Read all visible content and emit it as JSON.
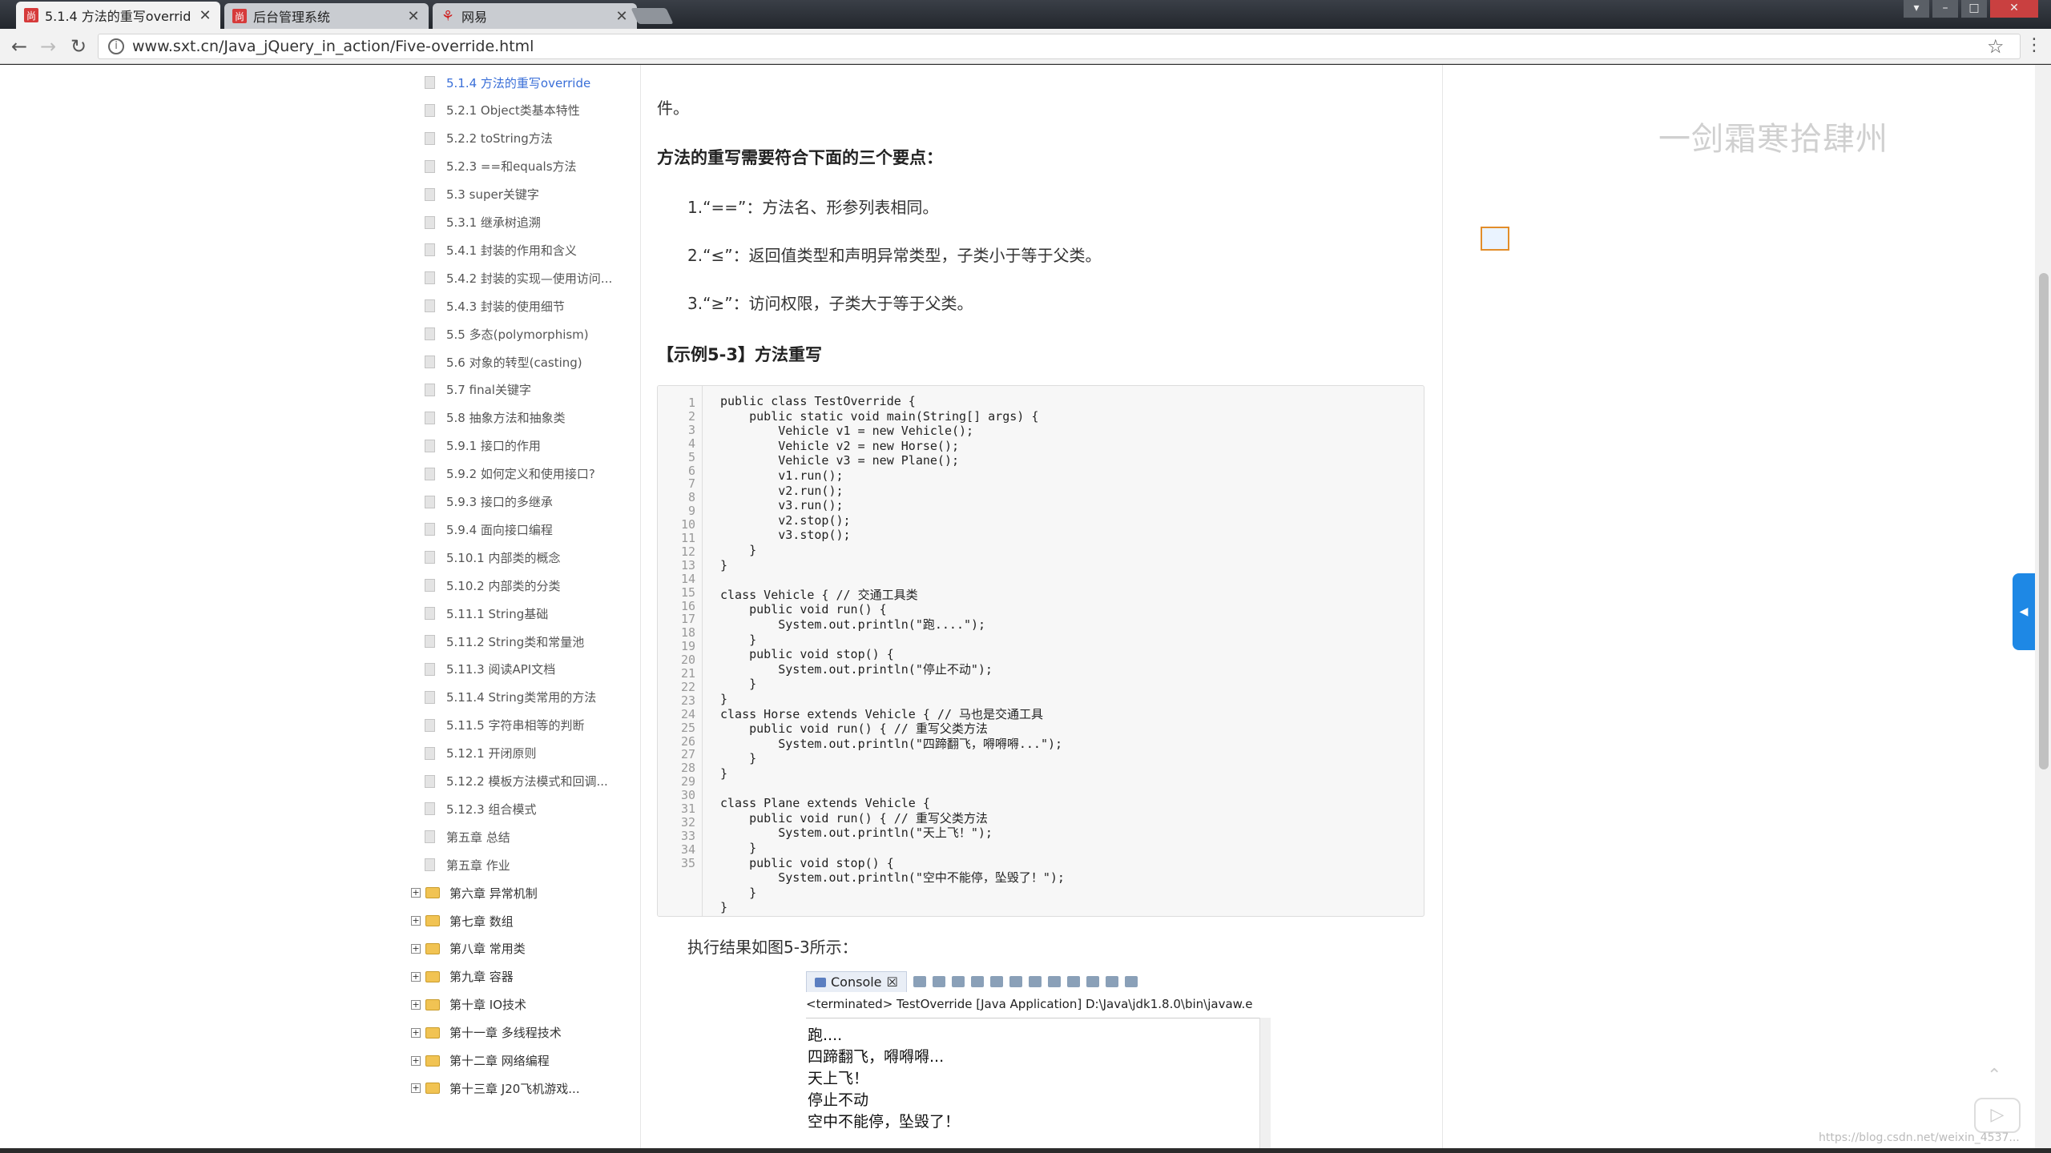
{
  "browser": {
    "tabs": [
      {
        "label": "5.1.4 方法的重写overrid",
        "favicon": "尚"
      },
      {
        "label": "后台管理系统",
        "favicon": "尚"
      },
      {
        "label": "网易",
        "favicon": "网"
      }
    ],
    "url": "www.sxt.cn/Java_jQuery_in_action/Five-override.html"
  },
  "toc": {
    "items": [
      {
        "label": "5.1.4 方法的重写override",
        "active": true
      },
      {
        "label": "5.2.1 Object类基本特性"
      },
      {
        "label": "5.2.2 toString方法"
      },
      {
        "label": "5.2.3 ==和equals方法"
      },
      {
        "label": "5.3 super关键字"
      },
      {
        "label": "5.3.1 继承树追溯"
      },
      {
        "label": "5.4.1 封装的作用和含义"
      },
      {
        "label": "5.4.2 封装的实现—使用访问..."
      },
      {
        "label": "5.4.3 封装的使用细节"
      },
      {
        "label": "5.5 多态(polymorphism)"
      },
      {
        "label": "5.6 对象的转型(casting)"
      },
      {
        "label": "5.7 final关键字"
      },
      {
        "label": "5.8 抽象方法和抽象类"
      },
      {
        "label": "5.9.1 接口的作用"
      },
      {
        "label": "5.9.2 如何定义和使用接口?"
      },
      {
        "label": "5.9.3 接口的多继承"
      },
      {
        "label": "5.9.4 面向接口编程"
      },
      {
        "label": "5.10.1 内部类的概念"
      },
      {
        "label": "5.10.2 内部类的分类"
      },
      {
        "label": "5.11.1 String基础"
      },
      {
        "label": "5.11.2 String类和常量池"
      },
      {
        "label": "5.11.3 阅读API文档"
      },
      {
        "label": "5.11.4 String类常用的方法"
      },
      {
        "label": "5.11.5 字符串相等的判断"
      },
      {
        "label": "5.12.1 开闭原则"
      },
      {
        "label": "5.12.2 模板方法模式和回调..."
      },
      {
        "label": "5.12.3 组合模式"
      },
      {
        "label": "第五章 总结"
      },
      {
        "label": "第五章 作业"
      }
    ],
    "chapters": [
      "第六章 异常机制",
      "第七章 数组",
      "第八章 常用类",
      "第九章 容器",
      "第十章 IO技术",
      "第十一章 多线程技术",
      "第十二章 网络编程",
      "第十三章 J20飞机游戏..."
    ]
  },
  "content": {
    "fragment": "件。",
    "heading": "方法的重写需要符合下面的三个要点：",
    "points": [
      "1.“==”：方法名、形参列表相同。",
      "2.“≤”：返回值类型和声明异常类型，子类小于等于父类。",
      "3.“≥”：访问权限，子类大于等于父类。"
    ],
    "example_title": "【示例5-3】方法重写",
    "code_lines": [
      "public class TestOverride {",
      "    public static void main(String[] args) {",
      "        Vehicle v1 = new Vehicle();",
      "        Vehicle v2 = new Horse();",
      "        Vehicle v3 = new Plane();",
      "        v1.run();",
      "        v2.run();",
      "        v3.run();",
      "        v2.stop();",
      "        v3.stop();",
      "    }",
      "}",
      "",
      "class Vehicle { // 交通工具类",
      "    public void run() {",
      "        System.out.println(\"跑....\");",
      "    }",
      "    public void stop() {",
      "        System.out.println(\"停止不动\");",
      "    }",
      "}",
      "class Horse extends Vehicle { // 马也是交通工具",
      "    public void run() { // 重写父类方法",
      "        System.out.println(\"四蹄翻飞，嘚嘚嘚...\");",
      "    }",
      "}",
      "",
      "class Plane extends Vehicle {",
      "    public void run() { // 重写父类方法",
      "        System.out.println(\"天上飞！\");",
      "    }",
      "    public void stop() {",
      "        System.out.println(\"空中不能停，坠毁了！\");",
      "    }",
      "}"
    ],
    "line_numbers": [
      "1",
      "2",
      "3",
      "4",
      "5",
      "6",
      "7",
      "8",
      "9",
      "10",
      "11",
      "12",
      "13",
      "14",
      "15",
      "16",
      "17",
      "18",
      "19",
      "20",
      "21",
      "22",
      "23",
      "24",
      "25",
      "26",
      "27",
      "28",
      "29",
      "30",
      "31",
      "32",
      "33",
      "34",
      "35"
    ],
    "result_text": "执行结果如图5-3所示："
  },
  "console": {
    "tab_label": "Console",
    "status": "<terminated> TestOverride [Java Application] D:\\Java\\jdk1.8.0\\bin\\javaw.e",
    "output": [
      "跑....",
      "四蹄翻飞，嘚嘚嘚...",
      "天上飞！",
      "停止不动",
      "空中不能停，坠毁了！"
    ]
  },
  "overlay": {
    "watermark": "一剑霜寒拾肆州",
    "footer_url": "https://blog.csdn.net/weixin_4537..."
  }
}
